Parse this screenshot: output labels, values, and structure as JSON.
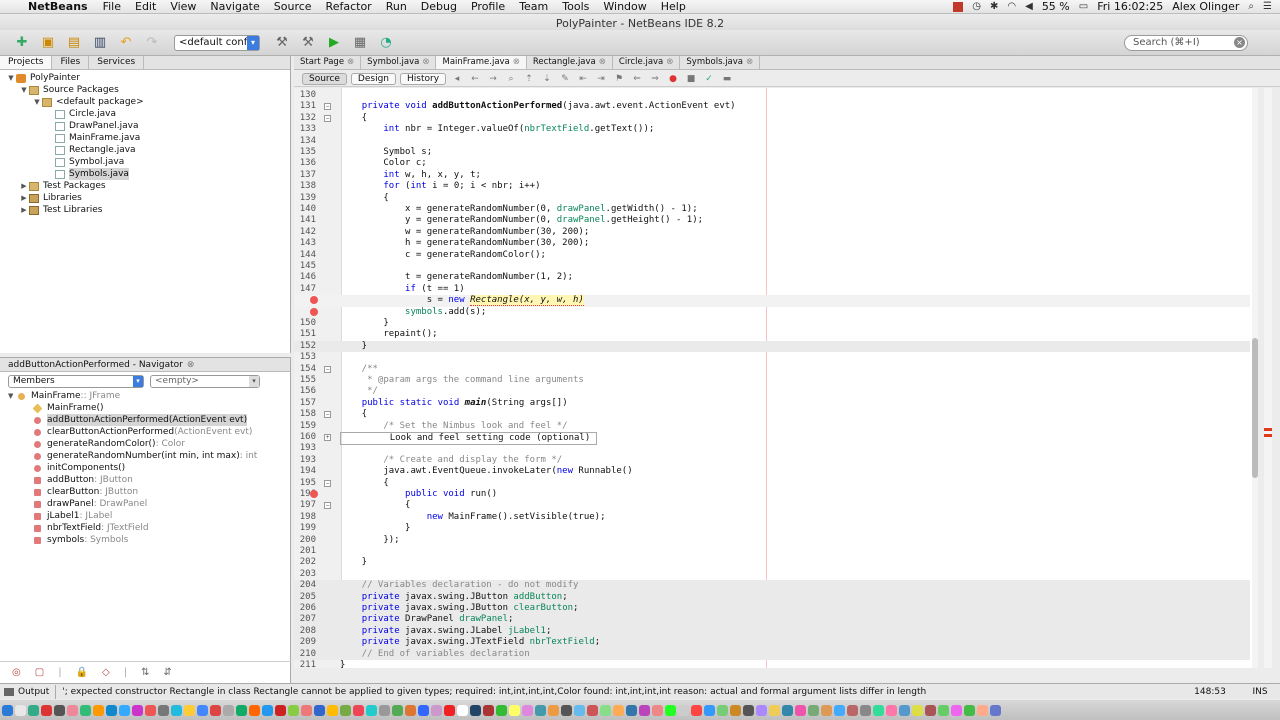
{
  "menubar": {
    "app_name": "NetBeans",
    "items": [
      "File",
      "Edit",
      "View",
      "Navigate",
      "Source",
      "Refactor",
      "Run",
      "Debug",
      "Profile",
      "Team",
      "Tools",
      "Window",
      "Help"
    ],
    "battery": "55 %",
    "clock": "Fri 16:02:25",
    "user": "Alex Olinger"
  },
  "window": {
    "title": "PolyPainter - NetBeans IDE 8.2"
  },
  "toolbar": {
    "config": "<default conf...",
    "search_placeholder": "Search (⌘+I)"
  },
  "projects": {
    "tabs": [
      "Projects",
      "Files",
      "Services"
    ],
    "tree": [
      {
        "label": "PolyPainter",
        "depth": 0,
        "icon": "project-icon",
        "expanded": true
      },
      {
        "label": "Source Packages",
        "depth": 1,
        "icon": "folder-icon",
        "expanded": true
      },
      {
        "label": "<default package>",
        "depth": 2,
        "icon": "package-icon",
        "expanded": true
      },
      {
        "label": "Circle.java",
        "depth": 3,
        "icon": "java-file-icon"
      },
      {
        "label": "DrawPanel.java",
        "depth": 3,
        "icon": "java-file-icon"
      },
      {
        "label": "MainFrame.java",
        "depth": 3,
        "icon": "java-file-icon"
      },
      {
        "label": "Rectangle.java",
        "depth": 3,
        "icon": "java-file-icon"
      },
      {
        "label": "Symbol.java",
        "depth": 3,
        "icon": "java-file-icon"
      },
      {
        "label": "Symbols.java",
        "depth": 3,
        "icon": "java-file-icon",
        "selected": true
      },
      {
        "label": "Test Packages",
        "depth": 1,
        "icon": "folder-icon",
        "expanded": false
      },
      {
        "label": "Libraries",
        "depth": 1,
        "icon": "library-icon",
        "expanded": false
      },
      {
        "label": "Test Libraries",
        "depth": 1,
        "icon": "library-icon",
        "expanded": false
      }
    ]
  },
  "navigator": {
    "title": "addButtonActionPerformed - Navigator",
    "members_select": "Members",
    "filter_select": "<empty>",
    "items": [
      {
        "name": "MainFrame",
        "type": " :: JFrame",
        "kind": "cls",
        "depth": 0
      },
      {
        "name": "MainFrame()",
        "type": "",
        "kind": "ctor",
        "depth": 1
      },
      {
        "name": "addButtonActionPerformed(ActionEvent evt)",
        "type": "",
        "kind": "method",
        "depth": 1,
        "selected": true
      },
      {
        "name": "clearButtonActionPerformed",
        "type": "(ActionEvent evt)",
        "kind": "method",
        "depth": 1
      },
      {
        "name": "generateRandomColor()",
        "type": " : Color",
        "kind": "method",
        "depth": 1
      },
      {
        "name": "generateRandomNumber(int min, int max)",
        "type": " : int",
        "kind": "method",
        "depth": 1
      },
      {
        "name": "initComponents()",
        "type": "",
        "kind": "method",
        "depth": 1
      },
      {
        "name": "addButton",
        "type": " : JButton",
        "kind": "field",
        "depth": 1
      },
      {
        "name": "clearButton",
        "type": " : JButton",
        "kind": "field",
        "depth": 1
      },
      {
        "name": "drawPanel",
        "type": " : DrawPanel",
        "kind": "field",
        "depth": 1
      },
      {
        "name": "jLabel1",
        "type": " : JLabel",
        "kind": "field",
        "depth": 1
      },
      {
        "name": "nbrTextField",
        "type": " : JTextField",
        "kind": "field",
        "depth": 1
      },
      {
        "name": "symbols",
        "type": " : Symbols",
        "kind": "field",
        "depth": 1
      }
    ]
  },
  "editor": {
    "tabs": [
      "Start Page",
      "Symbol.java",
      "MainFrame.java",
      "Rectangle.java",
      "Circle.java",
      "Symbols.java"
    ],
    "active_tab": 2,
    "view_buttons": [
      "Source",
      "Design",
      "History"
    ],
    "lines": [
      {
        "n": "130",
        "t": ""
      },
      {
        "n": "131",
        "t": "    private void addButtonActionPerformed(java.awt.event.ActionEvent evt)",
        "fold": "−",
        "style": "sig"
      },
      {
        "n": "132",
        "t": "    {",
        "fold": "−"
      },
      {
        "n": "133",
        "t": "        int nbr = Integer.valueOf(nbrTextField.getText());"
      },
      {
        "n": "134",
        "t": ""
      },
      {
        "n": "135",
        "t": "        Symbol s;"
      },
      {
        "n": "136",
        "t": "        Color c;"
      },
      {
        "n": "137",
        "t": "        int w, h, x, y, t;"
      },
      {
        "n": "138",
        "t": "        for (int i = 0; i < nbr; i++)"
      },
      {
        "n": "139",
        "t": "        {"
      },
      {
        "n": "140",
        "t": "            x = generateRandomNumber(0, drawPanel.getWidth() - 1);"
      },
      {
        "n": "141",
        "t": "            y = generateRandomNumber(0, drawPanel.getHeight() - 1);"
      },
      {
        "n": "142",
        "t": "            w = generateRandomNumber(30, 200);"
      },
      {
        "n": "143",
        "t": "            h = generateRandomNumber(30, 200);"
      },
      {
        "n": "144",
        "t": "            c = generateRandomColor();"
      },
      {
        "n": "145",
        "t": ""
      },
      {
        "n": "146",
        "t": "            t = generateRandomNumber(1, 2);"
      },
      {
        "n": "147",
        "t": "            if (t == 1)"
      },
      {
        "n": "",
        "t": "                s = new Rectangle(x, y, w, h)",
        "err": true,
        "style": "cur"
      },
      {
        "n": "",
        "t": "            symbols.add(s);",
        "err": true
      },
      {
        "n": "150",
        "t": "        }"
      },
      {
        "n": "151",
        "t": "        repaint();"
      },
      {
        "n": "152",
        "t": "    }",
        "style": "hl"
      },
      {
        "n": "153",
        "t": ""
      },
      {
        "n": "154",
        "t": "    /**",
        "fold": "−",
        "style": "cm"
      },
      {
        "n": "155",
        "t": "     * @param args the command line arguments",
        "style": "cm"
      },
      {
        "n": "156",
        "t": "     */",
        "style": "cm"
      },
      {
        "n": "157",
        "t": "    public static void main(String args[])"
      },
      {
        "n": "158",
        "t": "    {",
        "fold": "−"
      },
      {
        "n": "159",
        "t": "        /* Set the Nimbus look and feel */",
        "style": "cm"
      },
      {
        "n": "160",
        "t": "         Look and feel setting code (optional) ",
        "fold": "+"
      },
      {
        "n": "193",
        "t": ""
      },
      {
        "n": "193",
        "t": "        /* Create and display the form */",
        "style": "cm"
      },
      {
        "n": "194",
        "t": "        java.awt.EventQueue.invokeLater(new Runnable()"
      },
      {
        "n": "195",
        "t": "        {",
        "fold": "−"
      },
      {
        "n": "196",
        "t": "            public void run()",
        "err": true
      },
      {
        "n": "197",
        "t": "            {",
        "fold": "−"
      },
      {
        "n": "198",
        "t": "                new MainFrame().setVisible(true);"
      },
      {
        "n": "199",
        "t": "            }"
      },
      {
        "n": "200",
        "t": "        });"
      },
      {
        "n": "201",
        "t": ""
      },
      {
        "n": "202",
        "t": "    }"
      },
      {
        "n": "203",
        "t": ""
      },
      {
        "n": "204",
        "t": "    // Variables declaration - do not modify",
        "style": "gray cm"
      },
      {
        "n": "205",
        "t": "    private javax.swing.JButton addButton;",
        "style": "gray"
      },
      {
        "n": "206",
        "t": "    private javax.swing.JButton clearButton;",
        "style": "gray"
      },
      {
        "n": "207",
        "t": "    private DrawPanel drawPanel;",
        "style": "gray"
      },
      {
        "n": "208",
        "t": "    private javax.swing.JLabel jLabel1;",
        "style": "gray"
      },
      {
        "n": "209",
        "t": "    private javax.swing.JTextField nbrTextField;",
        "style": "gray"
      },
      {
        "n": "210",
        "t": "    // End of variables declaration",
        "style": "gray cm"
      },
      {
        "n": "211",
        "t": "}"
      },
      {
        "n": "212",
        "t": ""
      }
    ]
  },
  "statusbar": {
    "output_tab": "Output",
    "message": "'; expected  constructor Rectangle in class Rectangle cannot be applied to given types;  required: int,int,int,int,Color  found: int,int,int,int  reason: actual and formal argument lists differ in length",
    "caret": "148:53",
    "mode": "INS"
  },
  "colors": {
    "keyword": "#0000e6",
    "comment": "#888888",
    "error": "#e03a1a",
    "accent": "#3b7ce0"
  }
}
